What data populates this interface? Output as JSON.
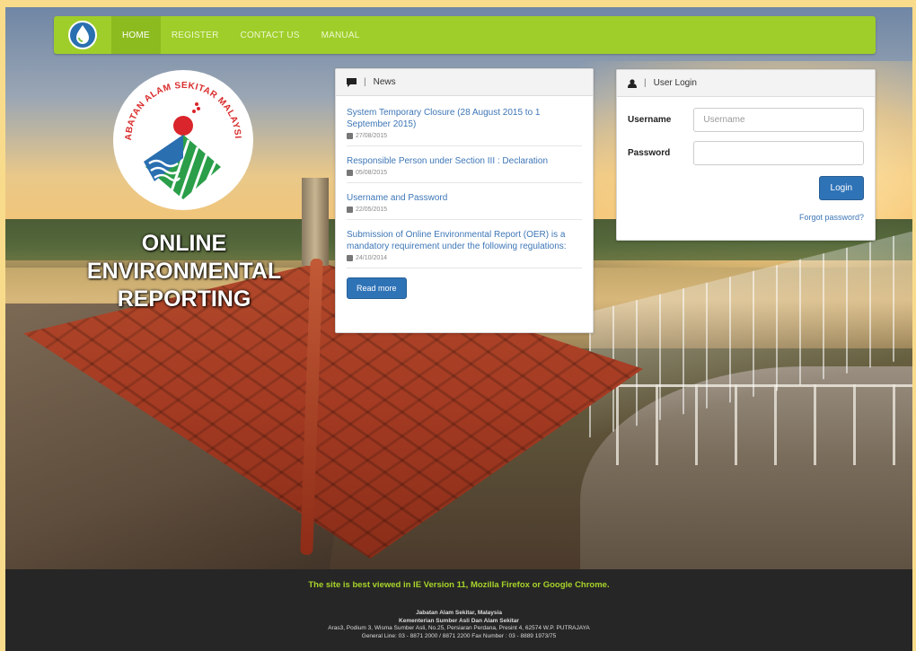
{
  "nav": {
    "items": [
      {
        "label": "HOME",
        "active": true
      },
      {
        "label": "REGISTER",
        "active": false
      },
      {
        "label": "CONTACT US",
        "active": false
      },
      {
        "label": "MANUAL",
        "active": false
      }
    ],
    "brand_icon": "water-drop-icon"
  },
  "logo": {
    "text": "JABATAN ALAM SEKITAR MALAYSIA"
  },
  "hero": {
    "title_line1": "ONLINE",
    "title_line2": "ENVIRONMENTAL",
    "title_line3": "REPORTING"
  },
  "news": {
    "heading": "News",
    "items": [
      {
        "title": "System Temporary Closure (28 August 2015 to 1 September 2015)",
        "date": "27/08/2015"
      },
      {
        "title": "Responsible Person under Section III : Declaration",
        "date": "05/08/2015"
      },
      {
        "title": "Username and Password",
        "date": "22/05/2015"
      },
      {
        "title": "Submission of Online Environmental Report (OER) is a mandatory requirement under the following regulations:",
        "date": "24/10/2014"
      }
    ],
    "read_more": "Read more"
  },
  "login": {
    "heading": "User Login",
    "username_label": "Username",
    "username_placeholder": "Username",
    "password_label": "Password",
    "password_placeholder": "",
    "submit": "Login",
    "forgot": "Forgot password?"
  },
  "footer": {
    "browser_note": "The site is best viewed in IE Version 11, Mozilla Firefox or Google Chrome.",
    "org_line1": "Jabatan Alam Sekitar, Malaysia",
    "org_line2": "Kementerian Sumber Asli Dan Alam Sekitar",
    "address": "Aras3, Podium 3, Wisma Sumber Asli, No.25, Persiaran Perdana, Presint 4, 62574 W.P. PUTRAJAYA",
    "phone": "General Line: 03 - 8871 2000 / 8871 2200 Fax Number : 03 - 8889 1973/75"
  },
  "colors": {
    "nav": "#9fce2a",
    "link": "#3d76b7",
    "button": "#2f73b7",
    "footer_bg": "#262626",
    "footer_note": "#a8d42a"
  }
}
